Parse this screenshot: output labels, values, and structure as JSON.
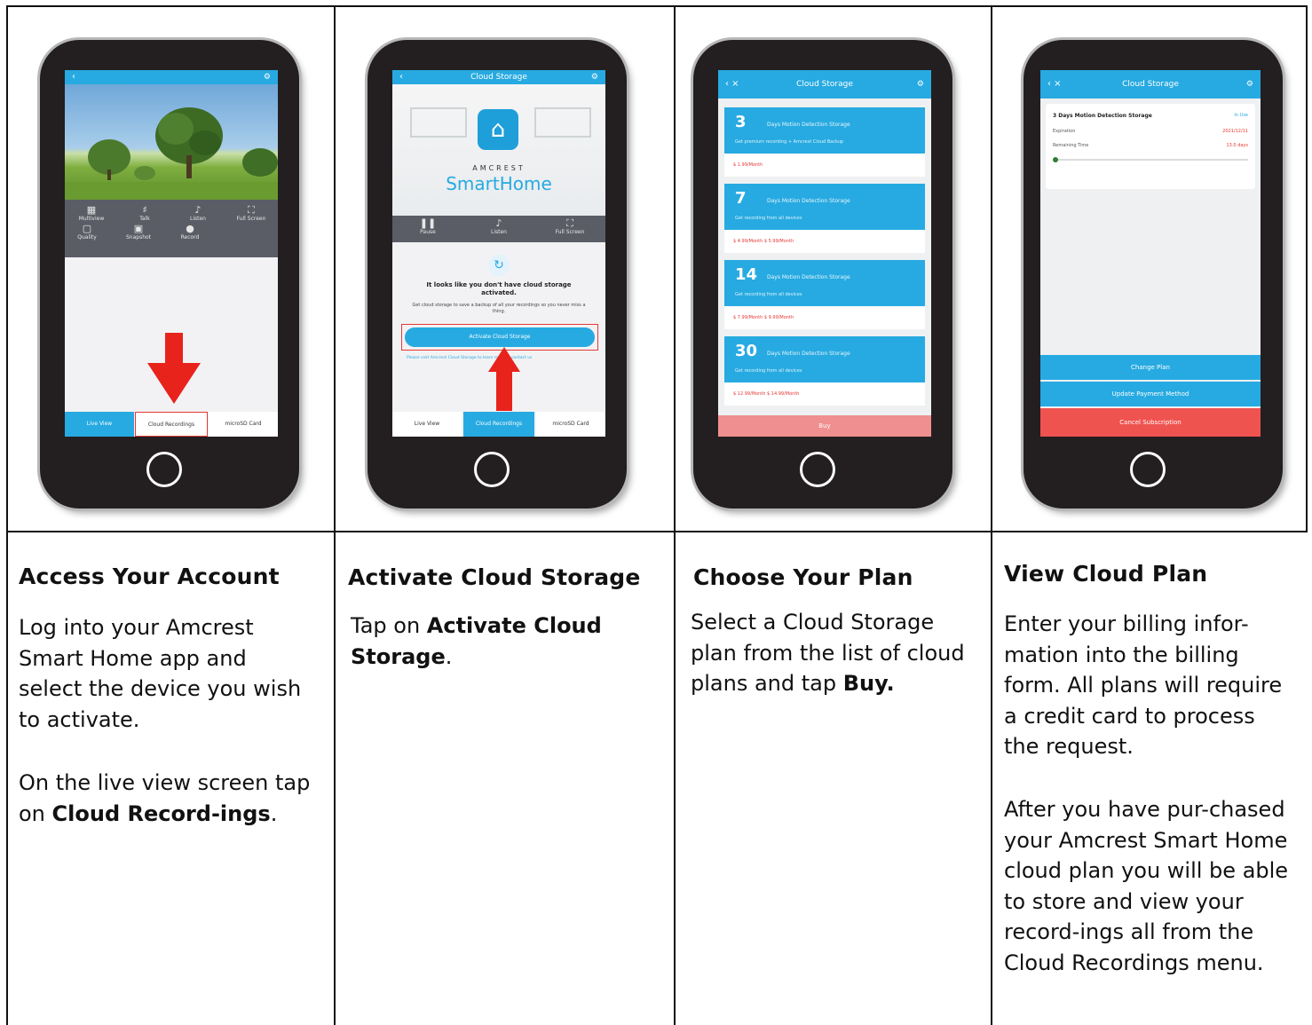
{
  "steps": [
    {
      "heading": "Access Your Account",
      "p1": "Log into your Amcrest Smart Home app and select the device you wish to activate.",
      "p2_pre": "On the live view screen tap on ",
      "p2_bold": "Cloud Record-ings",
      "p2_post": "."
    },
    {
      "heading": "Activate Cloud Storage",
      "p1_pre": "Tap on ",
      "p1_bold": "Activate Cloud Storage",
      "p1_post": "."
    },
    {
      "heading": "Choose Your Plan",
      "p1_pre": "Select a Cloud Storage plan from the list of cloud plans and tap ",
      "p1_bold": "Buy."
    },
    {
      "heading": "View Cloud Plan",
      "p1": "Enter your billing infor-mation into the billing form. All plans will require a credit card to process the request.",
      "p2": "After you have pur-chased your Amcrest Smart Home cloud plan you will be able to store and view your record-ings all from the Cloud Recordings menu."
    }
  ],
  "phones": {
    "p1": {
      "controls": [
        "Multiview",
        "Talk",
        "Listen",
        "Full Screen",
        "Quality",
        "Snapshot",
        "Record"
      ],
      "tabs": [
        "Live View",
        "Cloud Recordings",
        "microSD Card"
      ]
    },
    "p2": {
      "title": "Cloud Storage",
      "brand_top": "AMCREST",
      "brand_bottom": "SmartHome",
      "controls": [
        "Pause",
        "Listen",
        "Full Screen"
      ],
      "message": "It looks like you don't have cloud storage activated.",
      "sub": "Get cloud storage to save a backup of all your recordings so you never miss a thing.",
      "button": "Activate Cloud Storage",
      "link": "Please visit Amcrest Cloud Storage to learn more or contact us",
      "tabs": [
        "Live View",
        "Cloud Recordings",
        "microSD Card"
      ]
    },
    "p3": {
      "title": "Cloud Storage",
      "plans": [
        {
          "num": "3",
          "days": "Days   Motion Detection Storage",
          "sub": "Get premium recording + Amcrest Cloud Backup",
          "price": "$ 1.99/Month"
        },
        {
          "num": "7",
          "days": "Days   Motion Detection Storage",
          "sub": "Get recording from all devices",
          "price": "$ 4.99/Month   $ 5.99/Month"
        },
        {
          "num": "14",
          "days": "Days   Motion Detection Storage",
          "sub": "Get recording from all devices",
          "price": "$ 7.99/Month   $ 9.99/Month"
        },
        {
          "num": "30",
          "days": "Days   Motion Detection Storage",
          "sub": "Get recording from all devices",
          "price": "$ 12.99/Month   $ 14.99/Month"
        }
      ],
      "buy": "Buy"
    },
    "p4": {
      "title": "Cloud Storage",
      "plan_name": "3 Days Motion Detection Storage",
      "plan_status": "In Use",
      "row1_label": "Expiration",
      "row1_value": "2021/12/11",
      "row2_label": "Remaining Time",
      "row2_value": "13.0 days",
      "progress": 0.02,
      "btn1": "Change Plan",
      "btn2": "Update Payment Method",
      "btn3": "Cancel Subscription"
    }
  },
  "colors": {
    "accent": "#27aae1",
    "arrow": "#e53935",
    "phone": "#231f20",
    "cancel": "#ef5350",
    "buy": "#ef8f8f"
  }
}
